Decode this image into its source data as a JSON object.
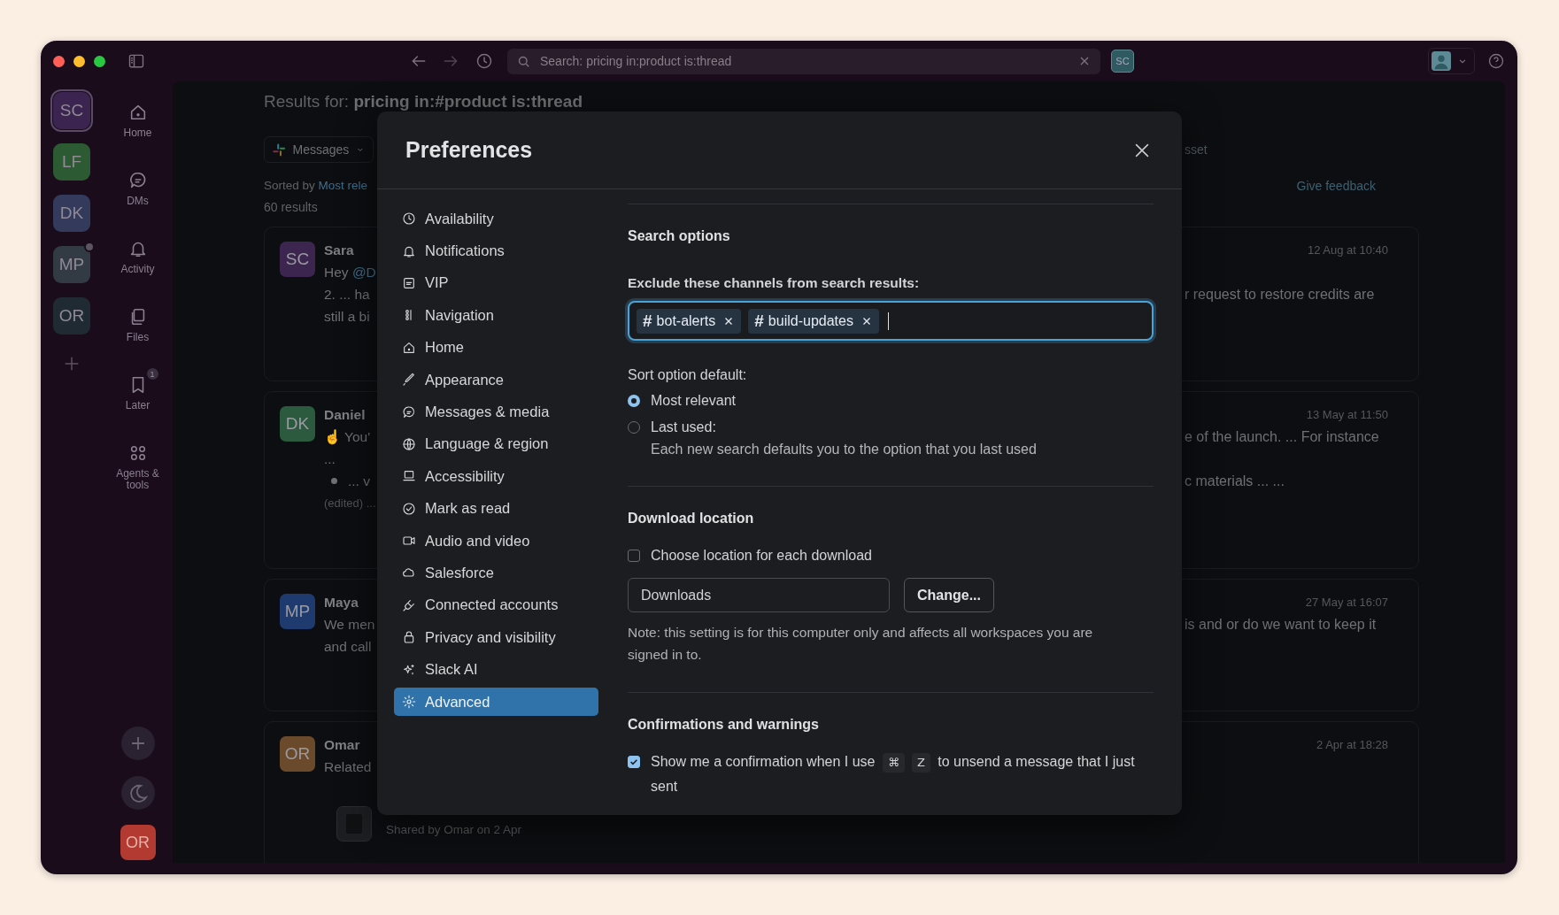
{
  "toolbar": {
    "search": {
      "value": "Search: pricing in:product is:thread"
    },
    "avatar": "SC"
  },
  "workspaces": [
    {
      "initials": "SC",
      "color": "#3b2450",
      "selected": true,
      "unread": false
    },
    {
      "initials": "LF",
      "color": "#2c5a33",
      "selected": false,
      "unread": false
    },
    {
      "initials": "DK",
      "color": "#333a5c",
      "selected": false,
      "unread": false
    },
    {
      "initials": "MP",
      "color": "#323a44",
      "selected": false,
      "unread": true
    },
    {
      "initials": "OR",
      "color": "#1f2a33",
      "selected": false,
      "unread": false
    }
  ],
  "nav": [
    {
      "kind": "home",
      "label": "Home"
    },
    {
      "kind": "dms",
      "label": "DMs"
    },
    {
      "kind": "activity",
      "label": "Activity"
    },
    {
      "kind": "files",
      "label": "Files"
    },
    {
      "kind": "later",
      "label": "Later",
      "badge": "1"
    },
    {
      "kind": "agents",
      "label": "Agents & tools"
    }
  ],
  "nav_footer": {
    "avatar": "OR"
  },
  "results": {
    "heading": "Results for: **pricing in:#product is:thread**",
    "filter": "Messages",
    "filter_2": "sset",
    "sorted_label": "Sorted by",
    "sort_value": "Most rele",
    "count": "60 results",
    "feedback": "Give feedback"
  },
  "messages": [
    {
      "initials": "SC",
      "color": "#3c2650",
      "author": "Sara",
      "time": "12 Aug at 10:40",
      "rows": [
        {
          "kind": "text",
          "left": "Hey ",
          "link": "@D"
        },
        {
          "kind": "text",
          "left": "2.  ...  ha",
          "right": "r request to restore credits are"
        },
        {
          "kind": "text",
          "left": "still a bi"
        }
      ]
    },
    {
      "initials": "DK",
      "color": "#2b5a3f",
      "author": "Daniel",
      "time": "13 May at 11:50",
      "rows": [
        {
          "kind": "text",
          "left": "☝ You'",
          "right": "e of the launch. ...  For instance"
        },
        {
          "kind": "text",
          "left": "..."
        },
        {
          "kind": "bullet",
          "left": "... v",
          "right": "c materials ...   ..."
        },
        {
          "kind": "note",
          "left": "(edited) ..."
        }
      ]
    },
    {
      "initials": "MP",
      "color": "#1e3a6e",
      "author": "Maya",
      "time": "27 May at 16:07",
      "rows": [
        {
          "kind": "text",
          "left": "We men",
          "right": "is and or do we want to keep it"
        },
        {
          "kind": "text",
          "left": "and call"
        }
      ]
    },
    {
      "initials": "OR",
      "color": "#6a4a2a",
      "author": "Omar",
      "time": "2 Apr at 18:28",
      "rows": [
        {
          "kind": "text",
          "left": "Related"
        },
        {
          "kind": "attachment",
          "caption": "Shared by Omar on 2 Apr"
        }
      ]
    }
  ],
  "preferences": {
    "title": "Preferences",
    "nav": [
      {
        "kind": "clock",
        "label": "Availability",
        "selected": false
      },
      {
        "kind": "bell",
        "label": "Notifications",
        "selected": false
      },
      {
        "kind": "vip",
        "label": "VIP",
        "selected": false
      },
      {
        "kind": "navigation",
        "label": "Navigation",
        "selected": false
      },
      {
        "kind": "home",
        "label": "Home",
        "selected": false
      },
      {
        "kind": "brush",
        "label": "Appearance",
        "selected": false
      },
      {
        "kind": "message",
        "label": "Messages & media",
        "selected": false
      },
      {
        "kind": "globe",
        "label": "Language & region",
        "selected": false
      },
      {
        "kind": "laptop",
        "label": "Accessibility",
        "selected": false
      },
      {
        "kind": "check",
        "label": "Mark as read",
        "selected": false
      },
      {
        "kind": "video",
        "label": "Audio and video",
        "selected": false
      },
      {
        "kind": "cloud",
        "label": "Salesforce",
        "selected": false
      },
      {
        "kind": "plug",
        "label": "Connected accounts",
        "selected": false
      },
      {
        "kind": "lock",
        "label": "Privacy and visibility",
        "selected": false
      },
      {
        "kind": "sparkle",
        "label": "Slack AI",
        "selected": false
      },
      {
        "kind": "gear",
        "label": "Advanced",
        "selected": true
      }
    ],
    "sections": [
      {
        "kind": "search",
        "heading": "Search options",
        "exclude_label": "Exclude these channels from search results:",
        "channels": [
          {
            "prefix": "#",
            "name": "bot-alerts"
          },
          {
            "prefix": "#",
            "name": "build-updates"
          }
        ],
        "sort_label": "Sort option default:",
        "options": [
          {
            "label": "Most relevant",
            "selected": true
          },
          {
            "label": "Last used:",
            "selected": false,
            "description": "Each new search defaults you to the option that you last used"
          }
        ]
      },
      {
        "kind": "download",
        "heading": "Download location",
        "checkbox": {
          "label": "Choose location for each download",
          "checked": false
        },
        "path": "Downloads",
        "button": "Change...",
        "note": "Note: this setting is for this computer only and affects all workspaces you are signed in to."
      },
      {
        "kind": "confirm",
        "heading": "Confirmations and warnings",
        "items": [
          {
            "checked": true,
            "before": "Show me a confirmation when I use",
            "keys": [
              "⌘",
              "Z"
            ],
            "after": "to unsend a message that I just sent"
          }
        ]
      }
    ]
  }
}
